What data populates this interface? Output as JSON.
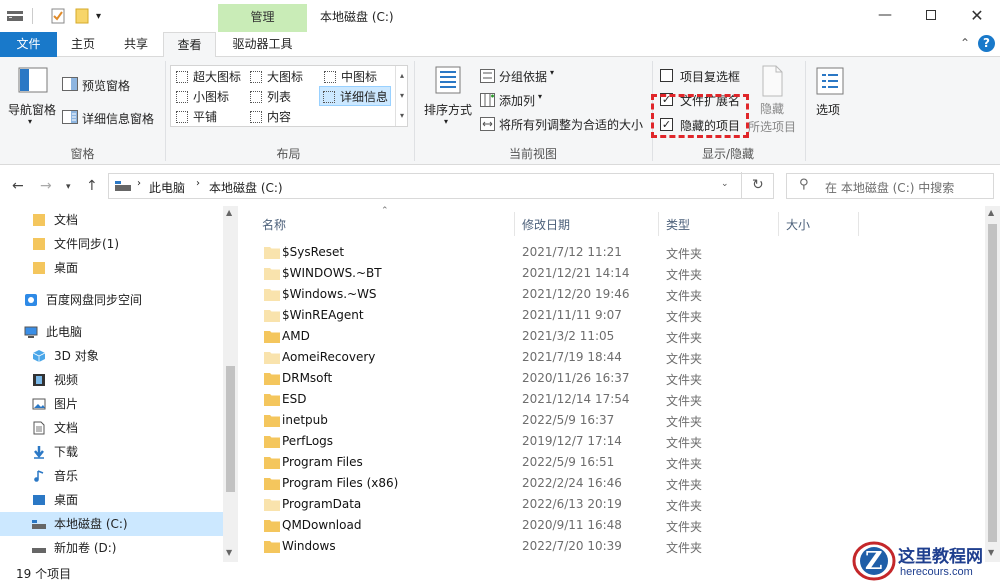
{
  "window": {
    "title": "本地磁盘 (C:)",
    "context_tab": "管理"
  },
  "tabs": {
    "file": "文件",
    "home": "主页",
    "share": "共享",
    "view": "查看",
    "drive_tools": "驱动器工具"
  },
  "ribbon": {
    "panes": {
      "nav_pane": "导航窗格",
      "preview_pane": "预览窗格",
      "details_pane": "详细信息窗格",
      "label": "窗格"
    },
    "layout": {
      "label": "布局",
      "items": [
        "超大图标",
        "大图标",
        "中图标",
        "小图标",
        "列表",
        "详细信息",
        "平铺",
        "内容"
      ],
      "selected": "详细信息"
    },
    "current_view": {
      "label": "当前视图",
      "sort_by": "排序方式",
      "group_by": "分组依据",
      "add_columns": "添加列",
      "size_all_columns": "将所有列调整为合适的大小"
    },
    "show_hide": {
      "label": "显示/隐藏",
      "item_checkboxes": "项目复选框",
      "item_checkboxes_checked": false,
      "file_extensions": "文件扩展名",
      "file_extensions_checked": true,
      "hidden_items": "隐藏的项目",
      "hidden_items_checked": true,
      "hide_selected_line1": "隐藏",
      "hide_selected_line2": "所选项目",
      "options": "选项"
    }
  },
  "address": {
    "crumbs": [
      "此电脑",
      "本地磁盘 (C:)"
    ],
    "search_placeholder": "在 本地磁盘 (C:) 中搜索"
  },
  "sidebar": {
    "items": [
      {
        "label": "文档",
        "icon": "folder-icon"
      },
      {
        "label": "文件同步(1)",
        "icon": "folder-icon"
      },
      {
        "label": "桌面",
        "icon": "folder-icon"
      },
      {
        "label": "百度网盘同步空间",
        "icon": "baidu-sync-icon"
      },
      {
        "label": "此电脑",
        "icon": "computer-icon"
      },
      {
        "label": "3D 对象",
        "icon": "cube-icon"
      },
      {
        "label": "视频",
        "icon": "video-icon"
      },
      {
        "label": "图片",
        "icon": "picture-icon"
      },
      {
        "label": "文档",
        "icon": "document-icon"
      },
      {
        "label": "下载",
        "icon": "download-icon"
      },
      {
        "label": "音乐",
        "icon": "music-icon"
      },
      {
        "label": "桌面",
        "icon": "desktop-icon"
      },
      {
        "label": "本地磁盘 (C:)",
        "icon": "drive-icon"
      },
      {
        "label": "新加卷 (D:)",
        "icon": "drive-icon"
      }
    ],
    "selected_index": 12
  },
  "columns": {
    "name": "名称",
    "date": "修改日期",
    "type": "类型",
    "size": "大小"
  },
  "files": [
    {
      "name": "$SysReset",
      "date": "2021/7/12 11:21",
      "type": "文件夹",
      "hidden": true
    },
    {
      "name": "$WINDOWS.~BT",
      "date": "2021/12/21 14:14",
      "type": "文件夹",
      "hidden": true
    },
    {
      "name": "$Windows.~WS",
      "date": "2021/12/20 19:46",
      "type": "文件夹",
      "hidden": true
    },
    {
      "name": "$WinREAgent",
      "date": "2021/11/11 9:07",
      "type": "文件夹",
      "hidden": true
    },
    {
      "name": "AMD",
      "date": "2021/3/2 11:05",
      "type": "文件夹",
      "hidden": false
    },
    {
      "name": "AomeiRecovery",
      "date": "2021/7/19 18:44",
      "type": "文件夹",
      "hidden": true
    },
    {
      "name": "DRMsoft",
      "date": "2020/11/26 16:37",
      "type": "文件夹",
      "hidden": false
    },
    {
      "name": "ESD",
      "date": "2021/12/14 17:54",
      "type": "文件夹",
      "hidden": false
    },
    {
      "name": "inetpub",
      "date": "2022/5/9 16:37",
      "type": "文件夹",
      "hidden": false
    },
    {
      "name": "PerfLogs",
      "date": "2019/12/7 17:14",
      "type": "文件夹",
      "hidden": false
    },
    {
      "name": "Program Files",
      "date": "2022/5/9 16:51",
      "type": "文件夹",
      "hidden": false
    },
    {
      "name": "Program Files (x86)",
      "date": "2022/2/24 16:46",
      "type": "文件夹",
      "hidden": false
    },
    {
      "name": "ProgramData",
      "date": "2022/6/13 20:19",
      "type": "文件夹",
      "hidden": true
    },
    {
      "name": "QMDownload",
      "date": "2020/9/11 16:48",
      "type": "文件夹",
      "hidden": false
    },
    {
      "name": "Windows",
      "date": "2022/7/20 10:39",
      "type": "文件夹",
      "hidden": false
    }
  ],
  "status": {
    "count": "19 个项目"
  },
  "watermark": {
    "logo_letter": "Z",
    "site_name": "这里教程网",
    "url": "herecours.com"
  },
  "colors": {
    "file_tab": "#1979ca",
    "context_tab": "#c9ecb7",
    "selection": "#cce8ff",
    "folder": "#f4c65d",
    "hidden_folder": "#f9e3ad",
    "highlight_box": "#e0262a"
  }
}
